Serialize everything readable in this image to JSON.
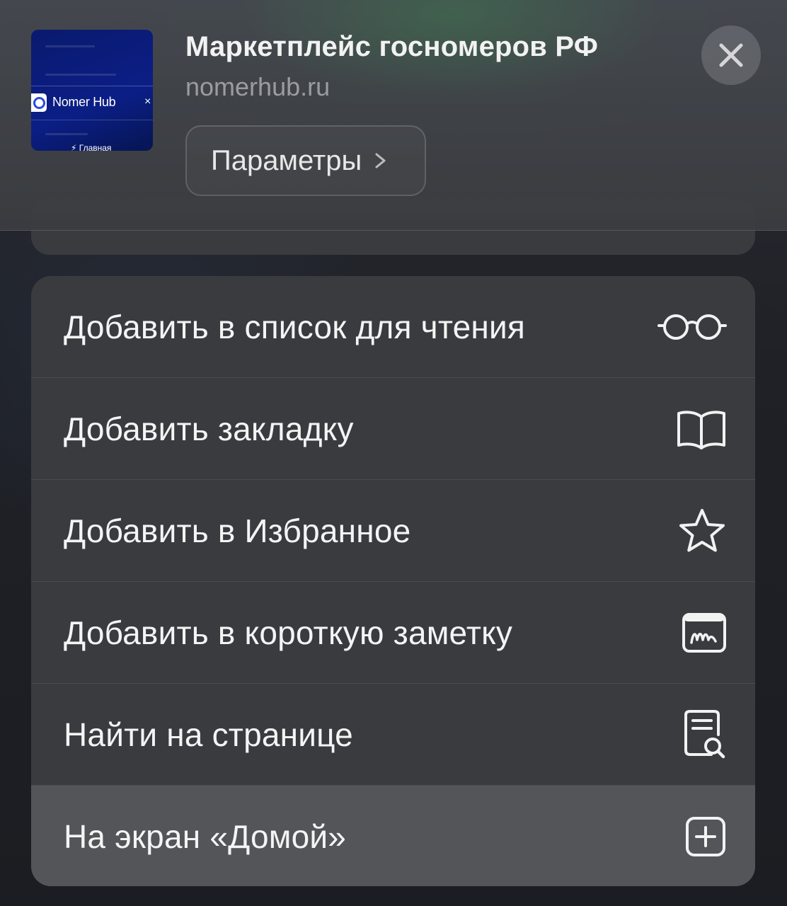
{
  "header": {
    "title": "Маркетплейс госномеров РФ",
    "domain": "nomerhub.ru",
    "params_label": "Параметры",
    "thumbnail": {
      "brand": "Nomer Hub",
      "close_glyph": "×",
      "nav_label": "⚡ Главная"
    },
    "close_icon": "close-icon"
  },
  "menu": {
    "items": [
      {
        "label": "Добавить в список для чтения",
        "icon": "reading-glasses-icon"
      },
      {
        "label": "Добавить закладку",
        "icon": "book-icon"
      },
      {
        "label": "Добавить в Избранное",
        "icon": "star-icon"
      },
      {
        "label": "Добавить в короткую заметку",
        "icon": "quick-note-icon"
      },
      {
        "label": "Найти на странице",
        "icon": "find-on-page-icon"
      },
      {
        "label": "На экран «Домой»",
        "icon": "add-square-icon",
        "selected": true
      }
    ]
  }
}
